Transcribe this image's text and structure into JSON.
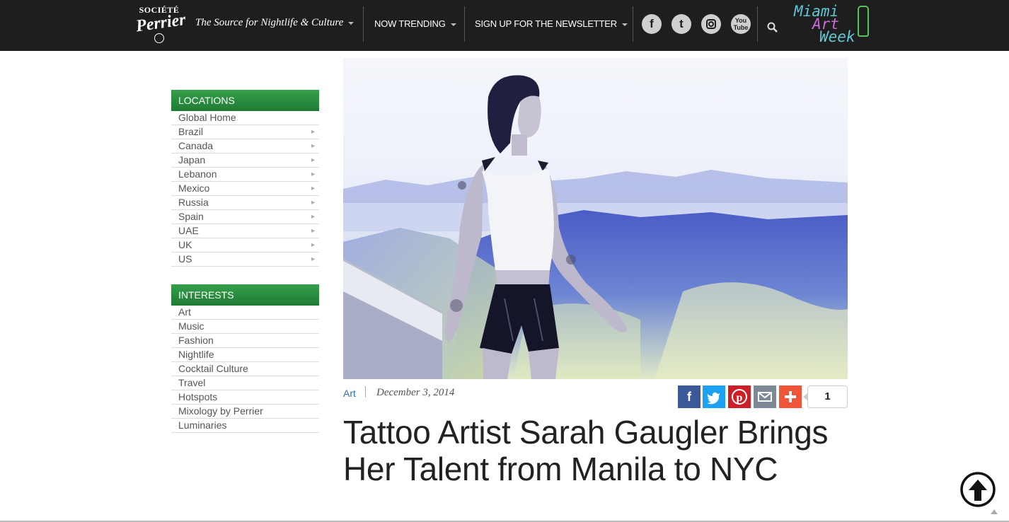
{
  "header": {
    "logo_line1": "SOCIÉTÉ",
    "logo_line2": "Perrier",
    "tagline": "The Source for Nightlife & Culture",
    "nav": [
      "NOW TRENDING",
      "SIGN UP FOR THE NEWSLETTER"
    ],
    "social": [
      "facebook-icon",
      "twitter-icon",
      "instagram-icon",
      "youtube-icon"
    ],
    "youtube_text": "You Tube",
    "promo": {
      "line1": "Miami",
      "line2": "Art",
      "line3": "Week"
    }
  },
  "sidebar": {
    "locations_title": "LOCATIONS",
    "locations": [
      "Global Home",
      "Brazil",
      "Canada",
      "Japan",
      "Lebanon",
      "Mexico",
      "Russia",
      "Spain",
      "UAE",
      "UK",
      "US"
    ],
    "interests_title": "INTERESTS",
    "interests": [
      "Art",
      "Music",
      "Fashion",
      "Nightlife",
      "Cocktail Culture",
      "Travel",
      "Hotspots",
      "Mixology by Perrier",
      "Luminaries"
    ]
  },
  "article": {
    "category": "Art",
    "date": "December 3, 2014",
    "share_count": "1",
    "title": "Tattoo Artist Sarah Gaugler Brings Her Talent from Manila to NYC"
  },
  "colors": {
    "topbar": "#1e1e1e",
    "sidebar_head": "#2e8f42",
    "link": "#2d70b8",
    "facebook": "#3b5998",
    "twitter": "#1da1f2",
    "pinterest": "#cb2027",
    "email": "#7d8a95",
    "more": "#f0553a"
  }
}
